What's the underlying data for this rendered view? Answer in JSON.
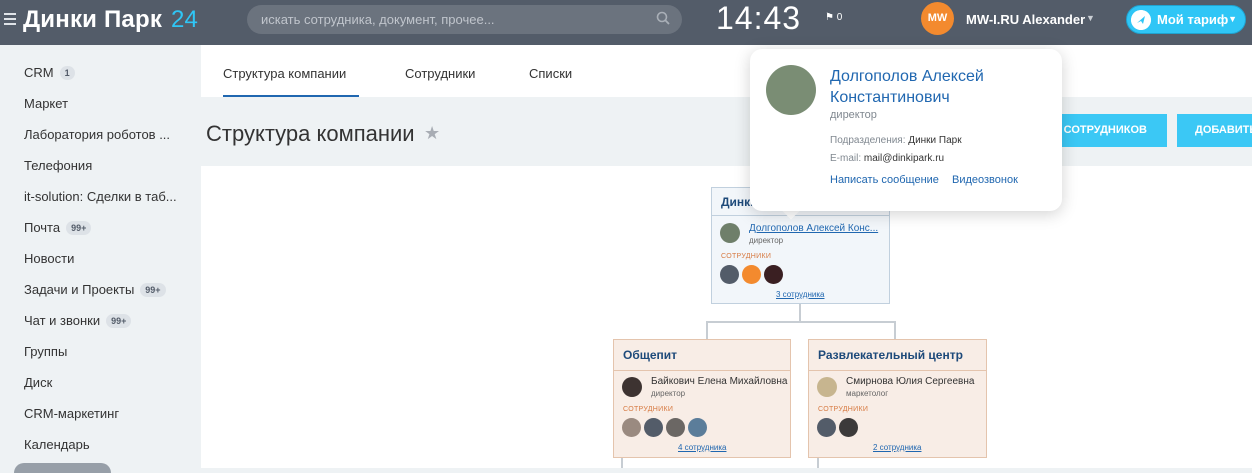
{
  "header": {
    "logo_name": "Динки Парк",
    "logo_num": "24",
    "search_placeholder": "искать сотрудника, документ, прочее...",
    "clock": "14:43",
    "flag_count": "0",
    "avatar_text": "MW",
    "user_name": "MW-I.RU Alexander",
    "tariff_label": "Мой тариф"
  },
  "sidebar": {
    "items": [
      {
        "label": "CRM",
        "badge": "1"
      },
      {
        "label": "Маркет",
        "badge": ""
      },
      {
        "label": "Лаборатория роботов ...",
        "badge": ""
      },
      {
        "label": "Телефония",
        "badge": ""
      },
      {
        "label": "it-solution: Сделки в таб...",
        "badge": ""
      },
      {
        "label": "Почта",
        "badge": "99+"
      },
      {
        "label": "Новости",
        "badge": ""
      },
      {
        "label": "Задачи и Проекты",
        "badge": "99+"
      },
      {
        "label": "Чат и звонки",
        "badge": "99+"
      },
      {
        "label": "Группы",
        "badge": ""
      },
      {
        "label": "Диск",
        "badge": ""
      },
      {
        "label": "CRM-маркетинг",
        "badge": ""
      },
      {
        "label": "Календарь",
        "badge": ""
      }
    ]
  },
  "tabs": [
    "Структура компании",
    "Сотрудники",
    "Списки"
  ],
  "page_title": "Структура компании",
  "buttons": {
    "invite": "Ь СОТРУДНИКОВ",
    "add": "ДОБАВИТЬ"
  },
  "org": {
    "root": {
      "title": "Динки Парк",
      "head_name": "Долгополов Алексей Конс...",
      "head_role": "директор",
      "staff_label": "СОТРУДНИКИ",
      "staff_link": "3 сотрудника"
    },
    "left": {
      "title": "Общепит",
      "head_name": "Байкович Елена Михайловна",
      "head_role": "директор",
      "staff_label": "СОТРУДНИКИ",
      "staff_link": "4 сотрудника"
    },
    "right": {
      "title": "Развлекательный центр",
      "head_name": "Смирнова Юлия Сергеевна",
      "head_role": "маркетолог",
      "staff_label": "СОТРУДНИКИ",
      "staff_link": "2 сотрудника"
    }
  },
  "popup": {
    "name": "Долгополов Алексей Константинович",
    "role": "директор",
    "dept_label": "Подразделения:",
    "dept_value": "Динки Парк",
    "email_label": "E-mail:",
    "email_value": "mail@dinkipark.ru",
    "message_link": "Написать сообщение",
    "video_link": "Видеозвонок"
  },
  "colors": {
    "header_bg": "#535c69",
    "accent": "#2fc6f6",
    "link": "#2067b0"
  }
}
